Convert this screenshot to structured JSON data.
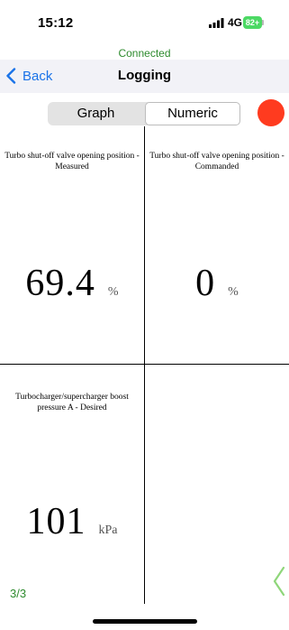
{
  "status_bar": {
    "time": "15:12",
    "network": "4G",
    "battery": "82+"
  },
  "connection": {
    "status": "Connected",
    "color": "#2e8b2e"
  },
  "nav": {
    "back_label": "Back",
    "title": "Logging"
  },
  "view_toggle": {
    "options": [
      "Graph",
      "Numeric"
    ],
    "selected": "Numeric"
  },
  "record_button": {
    "color": "#ff3b1f",
    "icon": "record-icon"
  },
  "gauges": [
    {
      "title": "Turbo shut-off valve opening position  -  Measured",
      "value": "69.4",
      "unit": "%"
    },
    {
      "title": "Turbo shut-off valve opening position  -  Commanded",
      "value": "0",
      "unit": "%"
    },
    {
      "title": "Turbocharger/supercharger boost pressure A  -  Desired",
      "value": "101",
      "unit": "kPa"
    }
  ],
  "pagination": {
    "indicator": "3/3",
    "next_icon": "chevron-left-icon"
  },
  "colors": {
    "accent": "#1a73e8",
    "connected": "#2e8b2e",
    "record": "#ff3b1f"
  }
}
